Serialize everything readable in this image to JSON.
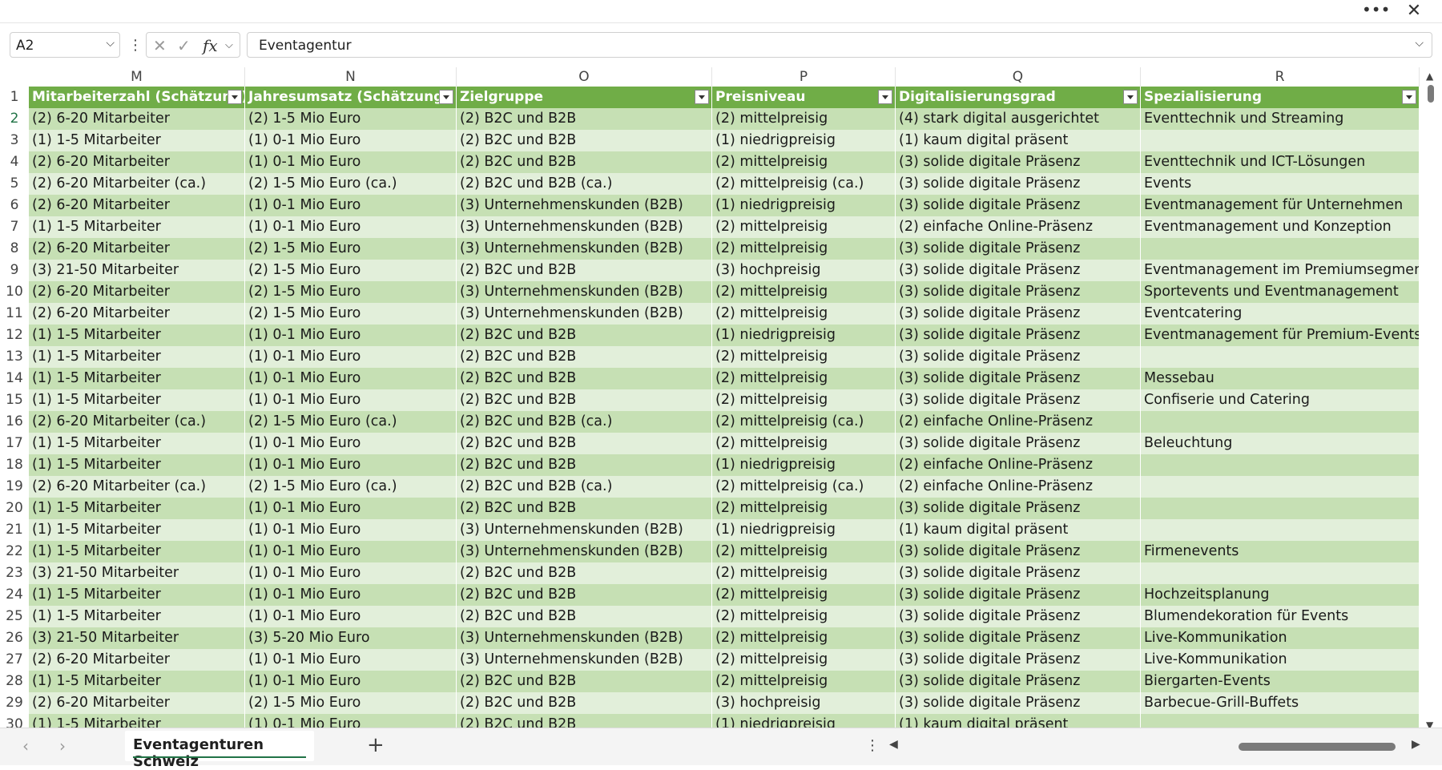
{
  "window": {
    "more_icon": "more-horizontal-icon",
    "close_icon": "close-icon"
  },
  "formula_bar": {
    "name_box": "A2",
    "formula_value": "Eventagentur"
  },
  "columns": [
    {
      "letter": "M",
      "header": "Mitarbeiterzahl (Schätzung)"
    },
    {
      "letter": "N",
      "header": "Jahresumsatz (Schätzung)"
    },
    {
      "letter": "O",
      "header": "Zielgruppe"
    },
    {
      "letter": "P",
      "header": "Preisniveau"
    },
    {
      "letter": "Q",
      "header": "Digitalisierungsgrad"
    },
    {
      "letter": "R",
      "header": "Spezialisierung"
    }
  ],
  "header_row_number": "1",
  "rows": [
    {
      "n": "2",
      "cells": [
        "(2) 6-20 Mitarbeiter",
        "(2) 1-5 Mio Euro",
        "(2) B2C und B2B",
        "(2) mittelpreisig",
        "(4) stark digital ausgerichtet",
        "Eventtechnik und Streaming"
      ]
    },
    {
      "n": "3",
      "cells": [
        "(1) 1-5 Mitarbeiter",
        "(1) 0-1 Mio Euro",
        "(2) B2C und B2B",
        "(1) niedrigpreisig",
        "(1) kaum digital präsent",
        ""
      ]
    },
    {
      "n": "4",
      "cells": [
        "(2) 6-20 Mitarbeiter",
        "(1) 0-1 Mio Euro",
        "(2) B2C und B2B",
        "(2) mittelpreisig",
        "(3) solide digitale Präsenz",
        "Eventtechnik und ICT-Lösungen"
      ]
    },
    {
      "n": "5",
      "cells": [
        "(2) 6-20 Mitarbeiter (ca.)",
        "(2) 1-5 Mio Euro (ca.)",
        "(2) B2C und B2B (ca.)",
        "(2) mittelpreisig (ca.)",
        "(3) solide digitale Präsenz",
        "Events"
      ]
    },
    {
      "n": "6",
      "cells": [
        "(2) 6-20 Mitarbeiter",
        "(1) 0-1 Mio Euro",
        "(3) Unternehmenskunden (B2B)",
        "(1) niedrigpreisig",
        "(3) solide digitale Präsenz",
        "Eventmanagement für Unternehmen"
      ]
    },
    {
      "n": "7",
      "cells": [
        "(1) 1-5 Mitarbeiter",
        "(1) 0-1 Mio Euro",
        "(3) Unternehmenskunden (B2B)",
        "(2) mittelpreisig",
        "(2) einfache Online-Präsenz",
        "Eventmanagement und Konzeption"
      ]
    },
    {
      "n": "8",
      "cells": [
        "(2) 6-20 Mitarbeiter",
        "(2) 1-5 Mio Euro",
        "(3) Unternehmenskunden (B2B)",
        "(2) mittelpreisig",
        "(3) solide digitale Präsenz",
        ""
      ]
    },
    {
      "n": "9",
      "cells": [
        "(3) 21-50 Mitarbeiter",
        "(2) 1-5 Mio Euro",
        "(2) B2C und B2B",
        "(3) hochpreisig",
        "(3) solide digitale Präsenz",
        "Eventmanagement im Premiumsegment"
      ]
    },
    {
      "n": "10",
      "cells": [
        "(2) 6-20 Mitarbeiter",
        "(2) 1-5 Mio Euro",
        "(3) Unternehmenskunden (B2B)",
        "(2) mittelpreisig",
        "(3) solide digitale Präsenz",
        "Sportevents und Eventmanagement"
      ]
    },
    {
      "n": "11",
      "cells": [
        "(2) 6-20 Mitarbeiter",
        "(2) 1-5 Mio Euro",
        "(3) Unternehmenskunden (B2B)",
        "(2) mittelpreisig",
        "(3) solide digitale Präsenz",
        "Eventcatering"
      ]
    },
    {
      "n": "12",
      "cells": [
        "(1) 1-5 Mitarbeiter",
        "(1) 0-1 Mio Euro",
        "(2) B2C und B2B",
        "(1) niedrigpreisig",
        "(3) solide digitale Präsenz",
        "Eventmanagement für Premium-Events"
      ]
    },
    {
      "n": "13",
      "cells": [
        "(1) 1-5 Mitarbeiter",
        "(1) 0-1 Mio Euro",
        "(2) B2C und B2B",
        "(2) mittelpreisig",
        "(3) solide digitale Präsenz",
        ""
      ]
    },
    {
      "n": "14",
      "cells": [
        "(1) 1-5 Mitarbeiter",
        "(1) 0-1 Mio Euro",
        "(2) B2C und B2B",
        "(2) mittelpreisig",
        "(3) solide digitale Präsenz",
        "Messebau"
      ]
    },
    {
      "n": "15",
      "cells": [
        "(1) 1-5 Mitarbeiter",
        "(1) 0-1 Mio Euro",
        "(2) B2C und B2B",
        "(2) mittelpreisig",
        "(3) solide digitale Präsenz",
        "Confiserie und Catering"
      ]
    },
    {
      "n": "16",
      "cells": [
        "(2) 6-20 Mitarbeiter (ca.)",
        "(2) 1-5 Mio Euro (ca.)",
        "(2) B2C und B2B (ca.)",
        "(2) mittelpreisig (ca.)",
        "(2) einfache Online-Präsenz",
        ""
      ]
    },
    {
      "n": "17",
      "cells": [
        "(1) 1-5 Mitarbeiter",
        "(1) 0-1 Mio Euro",
        "(2) B2C und B2B",
        "(2) mittelpreisig",
        "(3) solide digitale Präsenz",
        "Beleuchtung"
      ]
    },
    {
      "n": "18",
      "cells": [
        "(1) 1-5 Mitarbeiter",
        "(1) 0-1 Mio Euro",
        "(2) B2C und B2B",
        "(1) niedrigpreisig",
        "(2) einfache Online-Präsenz",
        ""
      ]
    },
    {
      "n": "19",
      "cells": [
        "(2) 6-20 Mitarbeiter (ca.)",
        "(2) 1-5 Mio Euro (ca.)",
        "(2) B2C und B2B (ca.)",
        "(2) mittelpreisig (ca.)",
        "(2) einfache Online-Präsenz",
        ""
      ]
    },
    {
      "n": "20",
      "cells": [
        "(1) 1-5 Mitarbeiter",
        "(1) 0-1 Mio Euro",
        "(2) B2C und B2B",
        "(2) mittelpreisig",
        "(3) solide digitale Präsenz",
        ""
      ]
    },
    {
      "n": "21",
      "cells": [
        "(1) 1-5 Mitarbeiter",
        "(1) 0-1 Mio Euro",
        "(3) Unternehmenskunden (B2B)",
        "(1) niedrigpreisig",
        "(1) kaum digital präsent",
        ""
      ]
    },
    {
      "n": "22",
      "cells": [
        "(1) 1-5 Mitarbeiter",
        "(1) 0-1 Mio Euro",
        "(3) Unternehmenskunden (B2B)",
        "(2) mittelpreisig",
        "(3) solide digitale Präsenz",
        "Firmenevents"
      ]
    },
    {
      "n": "23",
      "cells": [
        "(3) 21-50 Mitarbeiter",
        "(1) 0-1 Mio Euro",
        "(2) B2C und B2B",
        "(2) mittelpreisig",
        "(3) solide digitale Präsenz",
        ""
      ]
    },
    {
      "n": "24",
      "cells": [
        "(1) 1-5 Mitarbeiter",
        "(1) 0-1 Mio Euro",
        "(2) B2C und B2B",
        "(2) mittelpreisig",
        "(3) solide digitale Präsenz",
        "Hochzeitsplanung"
      ]
    },
    {
      "n": "25",
      "cells": [
        "(1) 1-5 Mitarbeiter",
        "(1) 0-1 Mio Euro",
        "(2) B2C und B2B",
        "(2) mittelpreisig",
        "(3) solide digitale Präsenz",
        "Blumendekoration für Events"
      ]
    },
    {
      "n": "26",
      "cells": [
        "(3) 21-50 Mitarbeiter",
        "(3) 5-20 Mio Euro",
        "(3) Unternehmenskunden (B2B)",
        "(2) mittelpreisig",
        "(3) solide digitale Präsenz",
        "Live-Kommunikation"
      ]
    },
    {
      "n": "27",
      "cells": [
        "(2) 6-20 Mitarbeiter",
        "(1) 0-1 Mio Euro",
        "(3) Unternehmenskunden (B2B)",
        "(2) mittelpreisig",
        "(3) solide digitale Präsenz",
        "Live-Kommunikation"
      ]
    },
    {
      "n": "28",
      "cells": [
        "(1) 1-5 Mitarbeiter",
        "(1) 0-1 Mio Euro",
        "(2) B2C und B2B",
        "(2) mittelpreisig",
        "(3) solide digitale Präsenz",
        "Biergarten-Events"
      ]
    },
    {
      "n": "29",
      "cells": [
        "(2) 6-20 Mitarbeiter",
        "(2) 1-5 Mio Euro",
        "(2) B2C und B2B",
        "(3) hochpreisig",
        "(3) solide digitale Präsenz",
        "Barbecue-Grill-Buffets"
      ]
    },
    {
      "n": "30",
      "cells": [
        "(1) 1-5 Mitarbeiter",
        "(1) 0-1 Mio Euro",
        "(2) B2C und B2B",
        "(1) niedrigpreisig",
        "(1) kaum digital präsent",
        ""
      ]
    }
  ],
  "sheet_tabs": [
    {
      "label": "Eventagenturen Schweiz",
      "active": true
    }
  ],
  "colors": {
    "header_green": "#70ad47",
    "band_dark": "#c6e0b4",
    "band_light": "#e2efda",
    "accent": "#217346"
  }
}
